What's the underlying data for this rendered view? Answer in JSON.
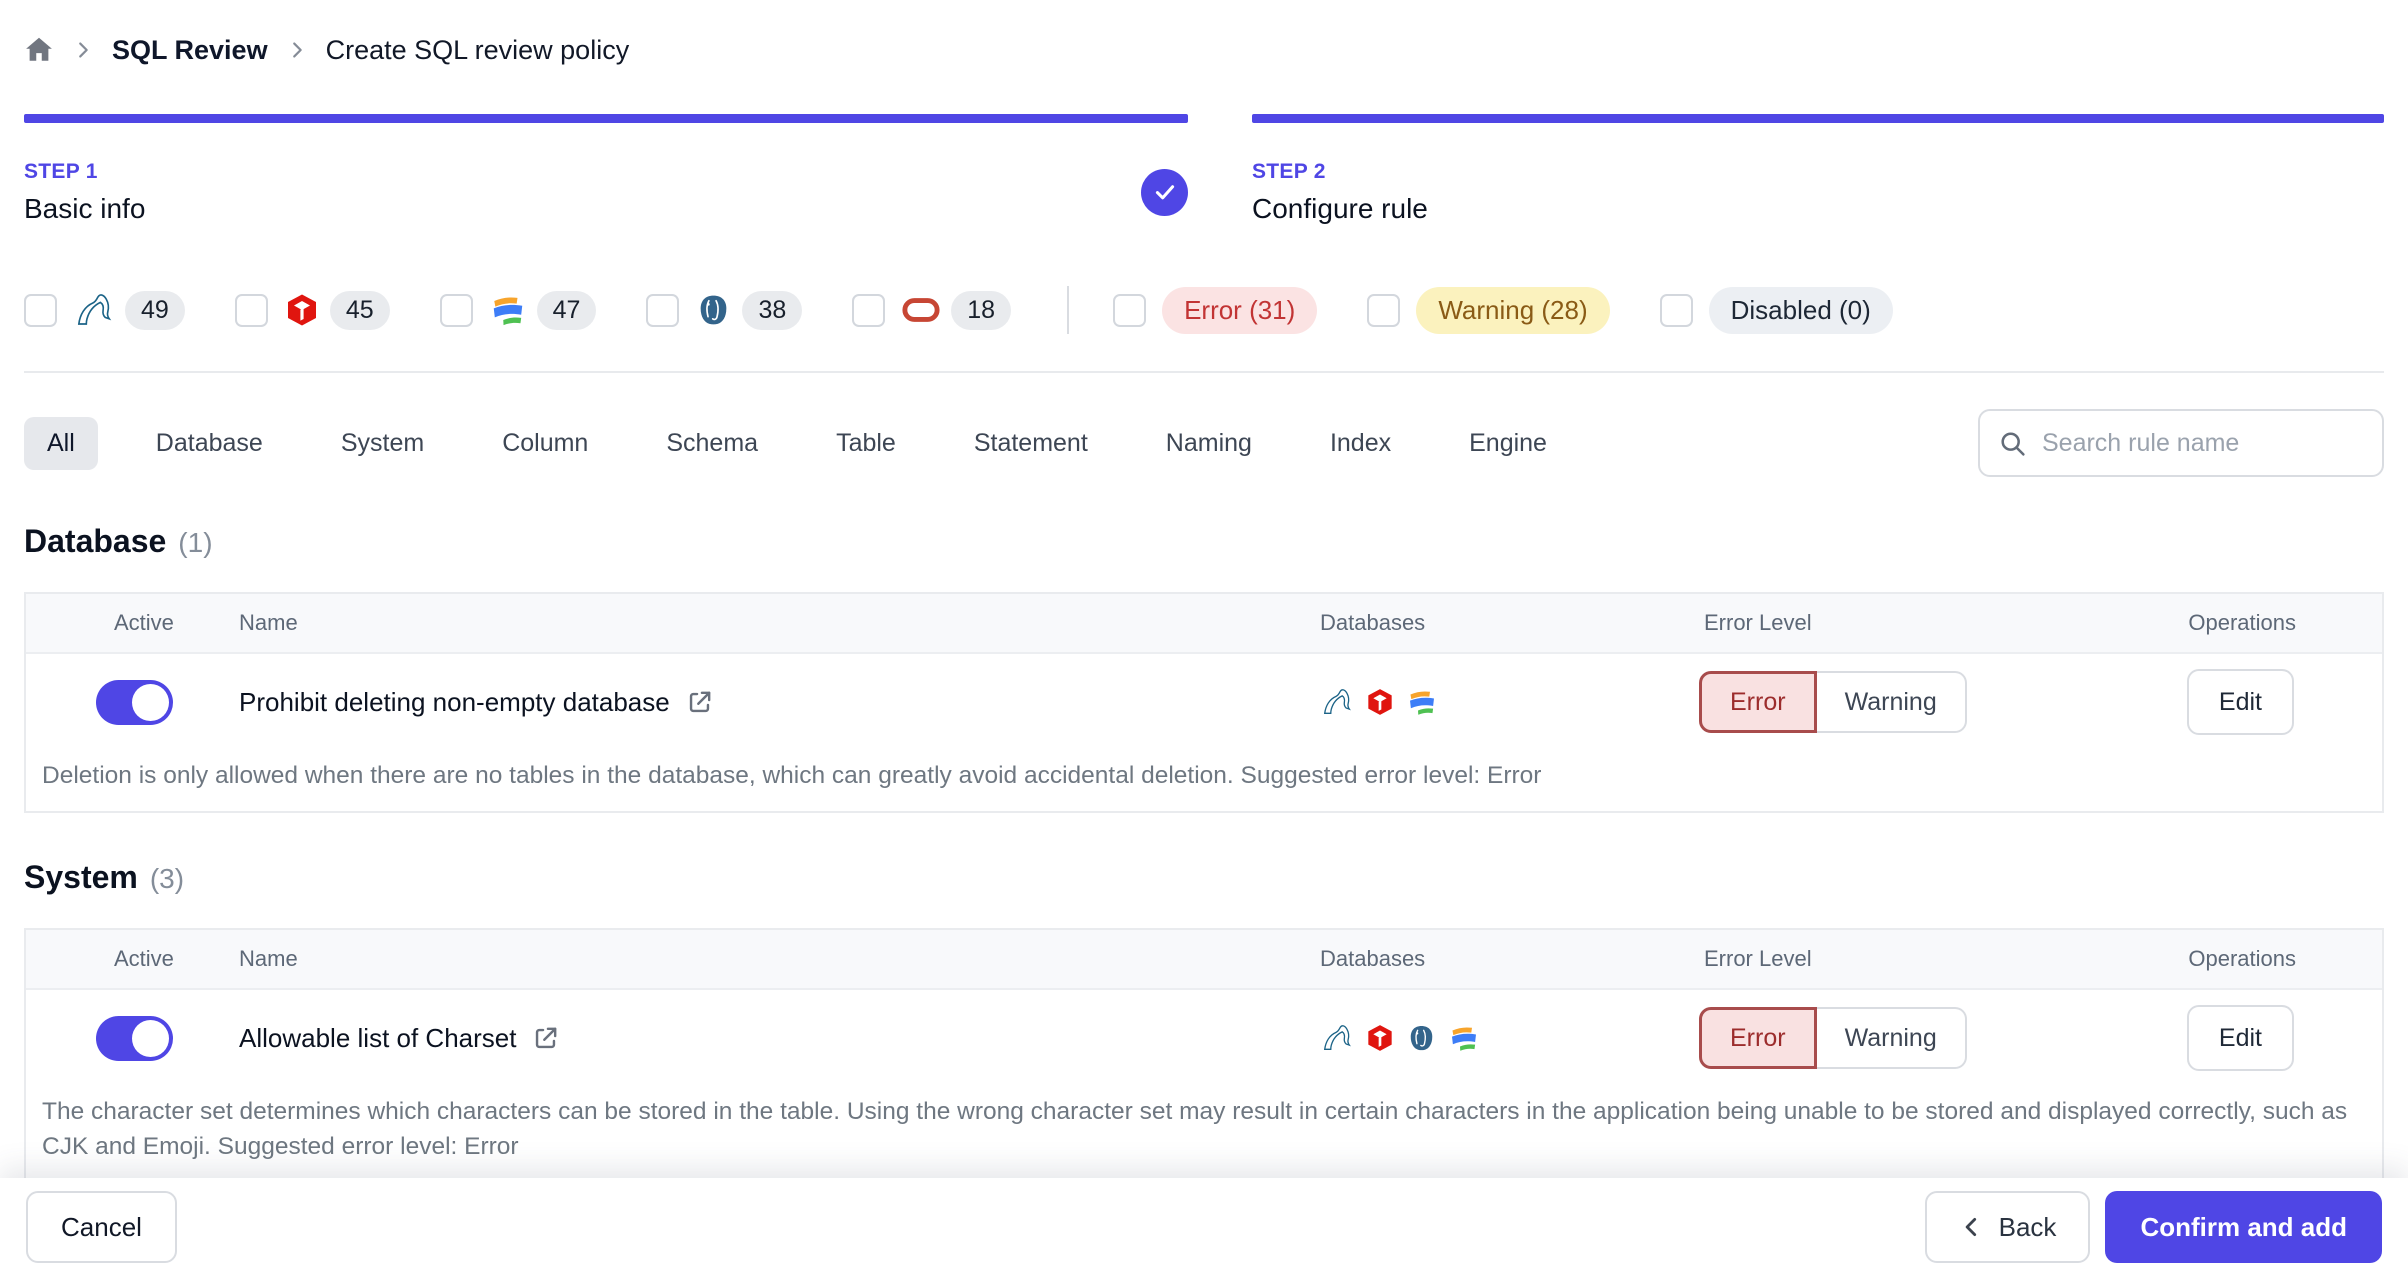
{
  "breadcrumb": {
    "items": [
      "SQL Review",
      "Create SQL review policy"
    ]
  },
  "stepper": {
    "steps": [
      {
        "label": "STEP 1",
        "title": "Basic info",
        "status": "completed"
      },
      {
        "label": "STEP 2",
        "title": "Configure rule",
        "status": "current"
      }
    ]
  },
  "filters": {
    "engines": [
      {
        "name": "MySQL",
        "count": "49"
      },
      {
        "name": "TiDB",
        "count": "45"
      },
      {
        "name": "OceanBase",
        "count": "47"
      },
      {
        "name": "PostgreSQL",
        "count": "38"
      },
      {
        "name": "Oracle",
        "count": "18"
      }
    ],
    "levels": [
      {
        "label": "Error (31)",
        "type": "error"
      },
      {
        "label": "Warning (28)",
        "type": "warning"
      },
      {
        "label": "Disabled (0)",
        "type": "disabled"
      }
    ]
  },
  "tabs": {
    "active": "All",
    "items": [
      "All",
      "Database",
      "System",
      "Column",
      "Schema",
      "Table",
      "Statement",
      "Naming",
      "Index",
      "Engine"
    ]
  },
  "search": {
    "placeholder": "Search rule name"
  },
  "sections": [
    {
      "title": "Database",
      "count": "(1)",
      "columns": {
        "active": "Active",
        "name": "Name",
        "databases": "Databases",
        "error_level": "Error Level",
        "operations": "Operations"
      },
      "rules": [
        {
          "name": "Prohibit deleting non-empty database",
          "active": true,
          "engines": [
            "MySQL",
            "TiDB",
            "OceanBase"
          ],
          "error_level": "Error",
          "level_options": {
            "error": "Error",
            "warning": "Warning"
          },
          "operation": "Edit",
          "description": "Deletion is only allowed when there are no tables in the database, which can greatly avoid accidental deletion. Suggested error level: Error"
        }
      ]
    },
    {
      "title": "System",
      "count": "(3)",
      "columns": {
        "active": "Active",
        "name": "Name",
        "databases": "Databases",
        "error_level": "Error Level",
        "operations": "Operations"
      },
      "rules": [
        {
          "name": "Allowable list of Charset",
          "active": true,
          "engines": [
            "MySQL",
            "TiDB",
            "PostgreSQL",
            "OceanBase"
          ],
          "error_level": "Error",
          "level_options": {
            "error": "Error",
            "warning": "Warning"
          },
          "operation": "Edit",
          "description": "The character set determines which characters can be stored in the table. Using the wrong character set may result in certain characters in the application being unable to be stored and displayed correctly, such as CJK and Emoji. Suggested error level: Error"
        }
      ]
    }
  ],
  "footer": {
    "cancel": "Cancel",
    "back": "Back",
    "confirm": "Confirm and add"
  },
  "colors": {
    "accent": "#4f46e5",
    "error_text": "#c23434",
    "error_bg": "#fbe3e3",
    "warning_text": "#8a5b16",
    "warning_bg": "#fbf2be",
    "disabled_bg": "#eceff3",
    "oracle_red": "#c74634",
    "postgres_blue": "#33648b",
    "tidb_red": "#e0150f"
  }
}
